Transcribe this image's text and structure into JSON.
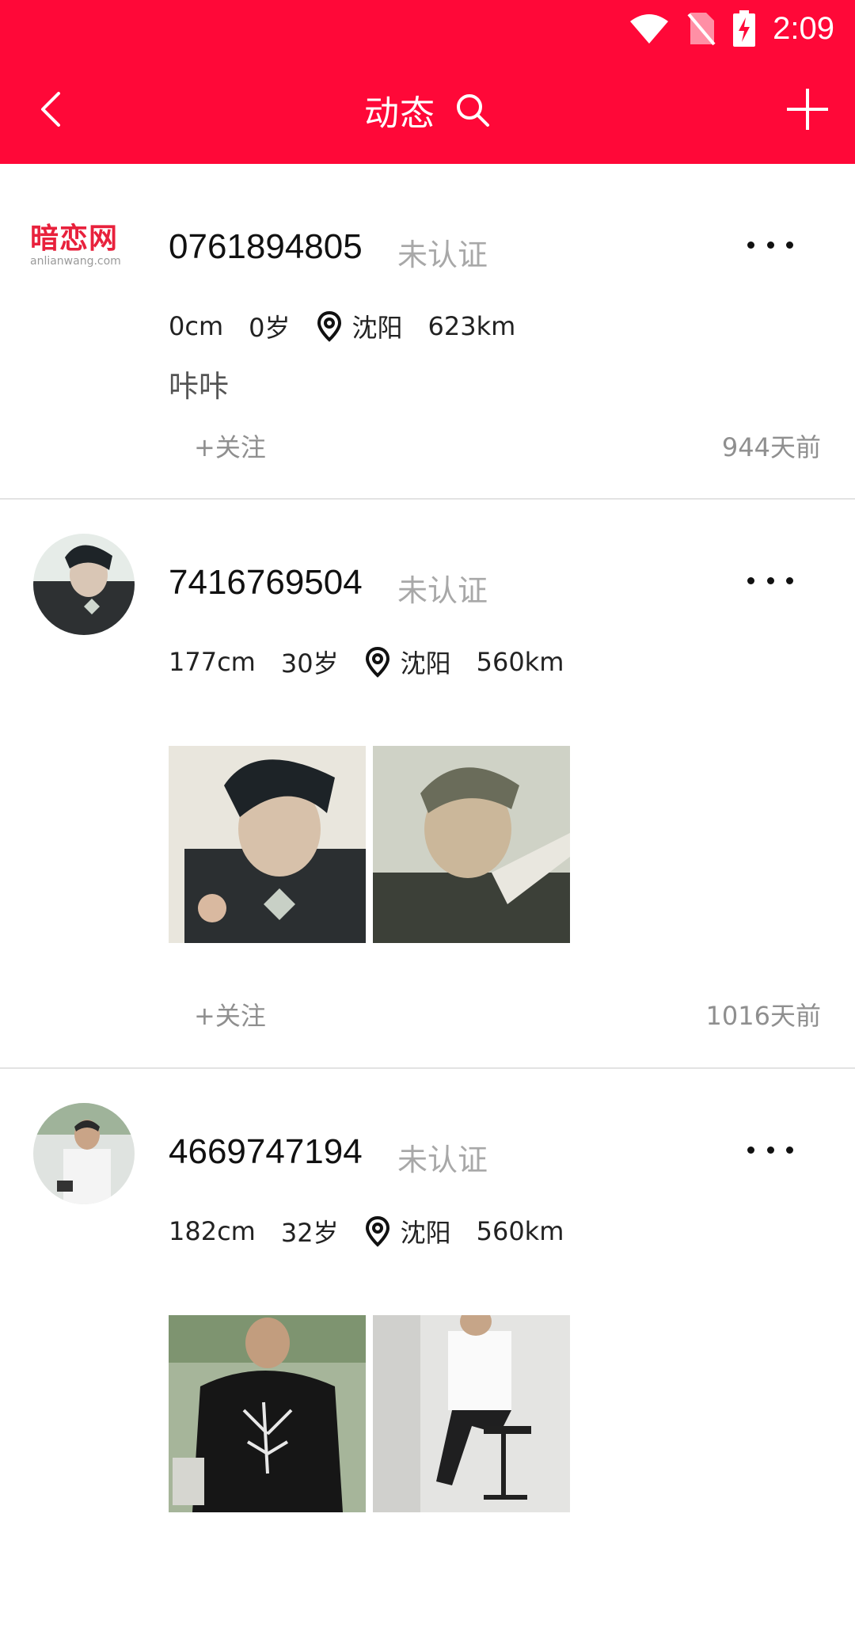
{
  "status_bar": {
    "time": "2:09",
    "icons": [
      "wifi-icon",
      "no-sim-icon",
      "battery-charging-icon"
    ]
  },
  "app_bar": {
    "title": "动态",
    "icons": [
      "back-arrow-icon",
      "search-icon",
      "add-icon"
    ]
  },
  "colors": {
    "accent": "#ff0838",
    "muted_text": "#a8a8a8",
    "divider": "#e3e3e3"
  },
  "posts": [
    {
      "avatar_logo": {
        "main": "暗恋网",
        "sub": "anlianwang.com"
      },
      "username": "0761894805",
      "verify": "未认证",
      "height": "0cm",
      "age": "0岁",
      "city": "沈阳",
      "distance": "623km",
      "text": "咔咔",
      "follow": "+关注",
      "time_ago": "944天前"
    },
    {
      "username": "7416769504",
      "verify": "未认证",
      "height": "177cm",
      "age": "30岁",
      "city": "沈阳",
      "distance": "560km",
      "follow": "+关注",
      "time_ago": "1016天前"
    },
    {
      "username": "4669747194",
      "verify": "未认证",
      "height": "182cm",
      "age": "32岁",
      "city": "沈阳",
      "distance": "560km"
    }
  ]
}
